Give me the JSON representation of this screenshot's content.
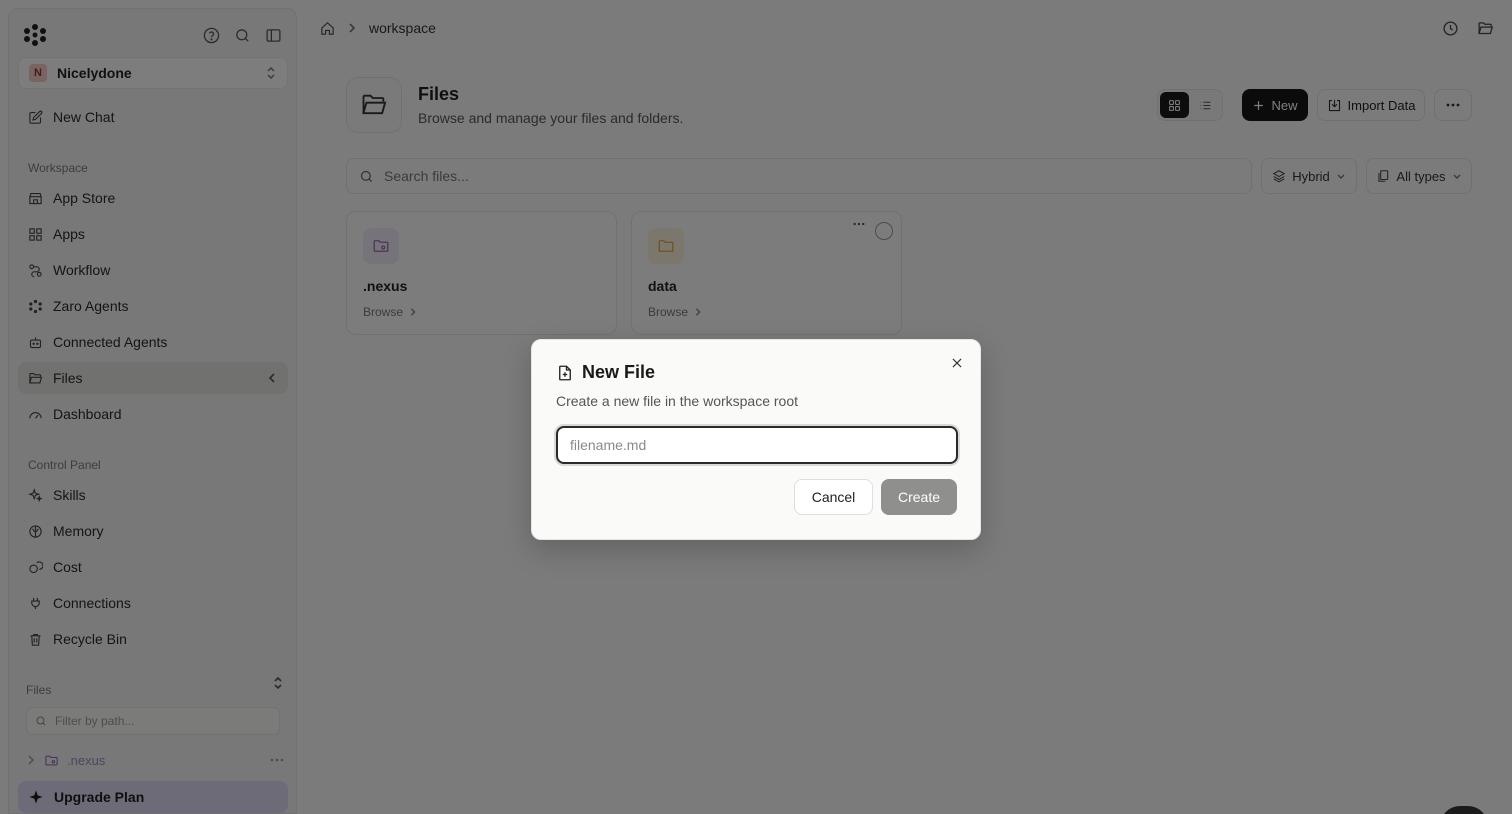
{
  "sidebar": {
    "workspace_name": "Nicelydone",
    "workspace_initial": "N",
    "new_chat": "New Chat",
    "workspace_label": "Workspace",
    "workspace_items": [
      "App Store",
      "Apps",
      "Workflow",
      "Zaro Agents",
      "Connected Agents",
      "Files",
      "Dashboard"
    ],
    "control_panel_label": "Control Panel",
    "control_items": [
      "Skills",
      "Memory",
      "Cost",
      "Connections",
      "Recycle Bin"
    ],
    "files_label": "Files",
    "filter_placeholder": "Filter by path...",
    "tree_item": ".nexus",
    "upgrade_label": "Upgrade Plan"
  },
  "breadcrumb": {
    "current": "workspace"
  },
  "header": {
    "title": "Files",
    "subtitle": "Browse and manage your files and folders.",
    "new_label": "New",
    "import_label": "Import Data"
  },
  "search": {
    "placeholder": "Search files..."
  },
  "filters": {
    "mode": "Hybrid",
    "types": "All types"
  },
  "cards": [
    {
      "name": ".nexus",
      "action": "Browse"
    },
    {
      "name": "data",
      "action": "Browse"
    }
  ],
  "dialog": {
    "title": "New File",
    "subtitle": "Create a new file in the workspace root",
    "input_placeholder": "filename.md",
    "cancel_label": "Cancel",
    "create_label": "Create"
  },
  "colors": {
    "accent": "#171717",
    "upgrade_bg": "#dcd6f3",
    "nexus_icon": "#9a6fb5",
    "data_icon": "#e0a93c"
  }
}
